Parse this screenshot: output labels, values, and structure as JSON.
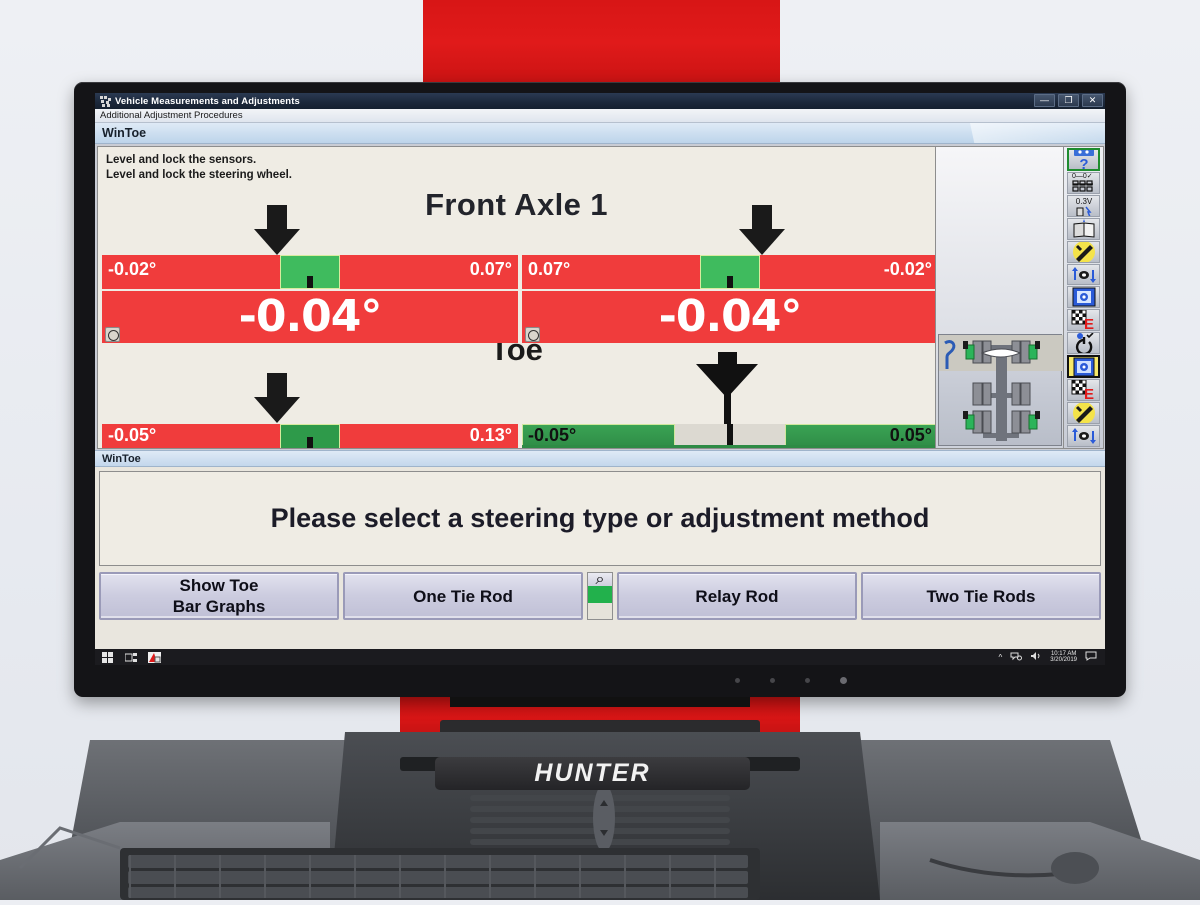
{
  "window": {
    "title": "Vehicle Measurements and Adjustments",
    "menu_item": "Additional Adjustment Procedures",
    "minimize": "—",
    "maximize": "❐",
    "close": "✕"
  },
  "top_panel": {
    "header": "WinToe"
  },
  "graph": {
    "instructions_line1": "Level and lock the sensors.",
    "instructions_line2": "Level and lock the steering wheel.",
    "axle_title": "Front Axle 1",
    "measurement_title": "Toe",
    "gauges": [
      {
        "position": "front-left",
        "left_value": "-0.02°",
        "right_value": "0.07°",
        "total_value": "-0.04°",
        "status": "red",
        "has_wheel_icon": true,
        "has_arrow": true
      },
      {
        "position": "front-right",
        "left_value": "0.07°",
        "right_value": "-0.02°",
        "total_value": "-0.04°",
        "status": "red",
        "has_wheel_icon": true,
        "has_arrow": true
      },
      {
        "position": "rear-left",
        "left_value": "-0.05°",
        "right_value": "0.13°",
        "status": "red",
        "has_wheel_icon": false,
        "has_arrow": true
      },
      {
        "position": "rear-right",
        "left_value": "-0.05°",
        "right_value": "0.05°",
        "status": "green",
        "has_wheel_icon": false,
        "has_arrow": true
      }
    ]
  },
  "toolbar": {
    "icons": [
      {
        "name": "help-question-icon",
        "selected": true
      },
      {
        "name": "specifications-icon",
        "selected": false
      },
      {
        "name": "battery-0.3v-icon",
        "selected": false
      },
      {
        "name": "book-manual-icon",
        "selected": false
      },
      {
        "name": "tools-wrench-icon",
        "selected": false
      },
      {
        "name": "wheel-arrows-icon",
        "selected": false
      },
      {
        "name": "camera-target-icon",
        "selected": false
      },
      {
        "name": "checkered-flag-e-icon",
        "selected": false
      },
      {
        "name": "steering-refresh-icon",
        "selected": false
      },
      {
        "name": "save-vault-icon",
        "selected": true
      },
      {
        "name": "checkered-flag-e2-icon",
        "selected": false
      },
      {
        "name": "tools-wrench2-icon",
        "selected": false
      },
      {
        "name": "wheel-arrows2-icon",
        "selected": false
      }
    ]
  },
  "vehicle_thumbnail": {
    "name": "truck-axle-diagram",
    "wrench_badge": "wrench-icon"
  },
  "bottom_panel": {
    "header": "WinToe",
    "message": "Please select a steering type or adjustment method"
  },
  "buttons": [
    {
      "label_line1": "Show Toe",
      "label_line2": "Bar Graphs",
      "name": "show-toe-bar-graphs-button"
    },
    {
      "label_line1": "One Tie Rod",
      "label_line2": "",
      "name": "one-tie-rod-button"
    },
    {
      "label_line1": "Relay Rod",
      "label_line2": "",
      "name": "relay-rod-button"
    },
    {
      "label_line1": "Two Tie Rods",
      "label_line2": "",
      "name": "two-tie-rods-button"
    }
  ],
  "magnifier_button": {
    "name": "magnifier-button",
    "glyph": "⌕"
  },
  "taskbar": {
    "start": "start-button",
    "task_view": "task-view-button",
    "app": "hunter-aligner-app-button",
    "chevron": "^",
    "network": "network-icon",
    "volume": "volume-icon",
    "time": "10:17 AM",
    "date": "3/20/2019",
    "notifications": "notification-icon"
  },
  "hardware": {
    "brand": "HUNTER"
  },
  "colors": {
    "red_bar": "#f03c3c",
    "green_bar": "#3fbb5e",
    "green_fill": "#2e8b45",
    "accent_blue": "#2b3a52",
    "panel_bg": "#efece4",
    "brand_red": "#d81616"
  }
}
